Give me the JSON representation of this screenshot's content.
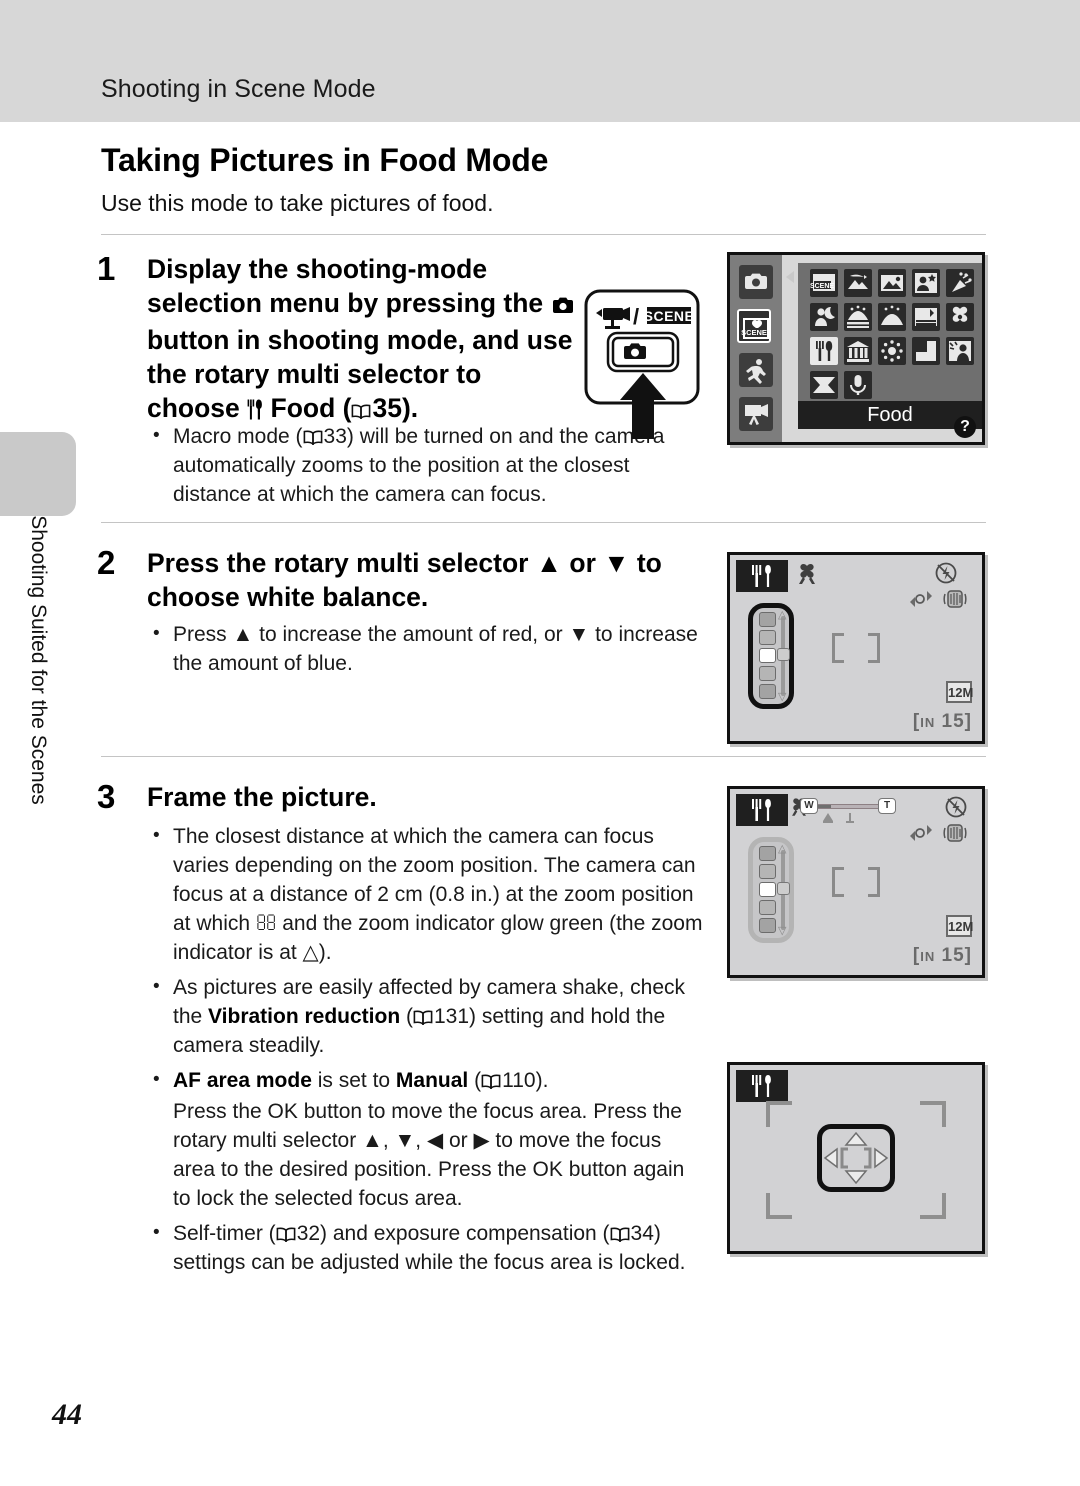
{
  "header": {
    "running_head": "Shooting in Scene Mode"
  },
  "sidebar": {
    "tab_label": "Shooting Suited for the Scenes"
  },
  "page": {
    "number": "44"
  },
  "main": {
    "title": "Taking Pictures in Food Mode",
    "lede": "Use this mode to take pictures of food.",
    "steps": [
      {
        "number": "1",
        "title_parts": {
          "p1": "Display the shooting-mode selection menu by pressing the ",
          "p2": " button in shooting mode, and use the rotary multi selector to choose ",
          "p3": " ",
          "bold_food": "Food",
          "p4": " (",
          "ref": "35",
          "p5": ")."
        },
        "bullets": [
          {
            "pre": "Macro mode (",
            "ref": "33",
            "post": ") will be turned on and the camera automatically zooms to the position at the closest distance at which the camera can focus."
          }
        ]
      },
      {
        "number": "2",
        "title": "Press the rotary multi selector ▲ or ▼ to choose white balance.",
        "bullets": [
          {
            "text": "Press ▲ to increase the amount of red, or ▼ to increase the amount of blue."
          }
        ]
      },
      {
        "number": "3",
        "title": "Frame the picture.",
        "bullets": [
          {
            "text": "The closest distance at which the camera can focus varies depending on the zoom position. The camera can focus at a distance of 2 cm (0.8 in.) at the zoom position at which  and the zoom indicator glow green (the zoom indicator is at △)."
          },
          {
            "pre": "As pictures are easily affected by camera shake, check the ",
            "bold": "Vibration reduction",
            "mid": " (",
            "ref": "131",
            "post": ") setting and hold the camera steadily."
          },
          {
            "bold1": "AF area mode",
            "mid1": " is set to ",
            "bold2": "Manual",
            "mid2": " (",
            "ref": "110",
            "post": ").",
            "cont": "Press the OK button to move the focus area. Press the rotary multi selector ▲, ▼, ◀ or ▶ to move the focus area to the desired position. Press the OK button again to lock the selected focus area."
          },
          {
            "pre": "Self-timer (",
            "ref": "32",
            "mid": ") and exposure compensation (",
            "ref2": "34",
            "post": ") settings can be adjusted while the focus area is locked."
          }
        ]
      }
    ]
  },
  "illustrations": {
    "button_diagram": {
      "movie_scene_label": "SCENE",
      "icon_names": [
        "movie-mode-icon",
        "scene-mode-icon",
        "camera-button-icon",
        "press-arrow-icon"
      ]
    },
    "scene_menu": {
      "selected_label": "Food",
      "help_glyph": "?",
      "mode_tabs": [
        "auto-mode-icon",
        "scene-mode-icon",
        "sport-mode-icon",
        "movie-mode-icon"
      ],
      "selected_tab_index": 1,
      "scene_icons": [
        "scene-auto-selector-icon",
        "night-landscape-icon",
        "landscape-icon",
        "portrait-frame-icon",
        "party-indoor-icon",
        "night-portrait-icon",
        "beach-icon",
        "snow-icon",
        "sunset-icon",
        "close-up-icon",
        "food-icon",
        "museum-icon",
        "fireworks-icon",
        "copy-icon",
        "backlight-icon",
        "panorama-icon",
        "voice-recording-icon"
      ],
      "selected_scene_index": 10
    },
    "lcd_white_balance": {
      "mode_icon": "food-icon",
      "macro_icon": "macro-flower-icon",
      "flash_icon": "flash-off-icon",
      "motion_icon": "motion-detection-icon",
      "vr_icon": "vibration-reduction-icon",
      "image_size": "12M",
      "memory_label": "IN",
      "shots_remaining": "15"
    },
    "lcd_zoom": {
      "mode_icon": "food-icon",
      "macro_icon": "macro-flower-icon",
      "zoom_wide_label": "W",
      "zoom_tele_label": "T",
      "flash_icon": "flash-off-icon",
      "image_size": "12M",
      "memory_label": "IN",
      "shots_remaining": "15"
    },
    "lcd_focus_area": {
      "mode_icon": "food-icon",
      "directions": [
        "up",
        "down",
        "left",
        "right"
      ]
    }
  }
}
